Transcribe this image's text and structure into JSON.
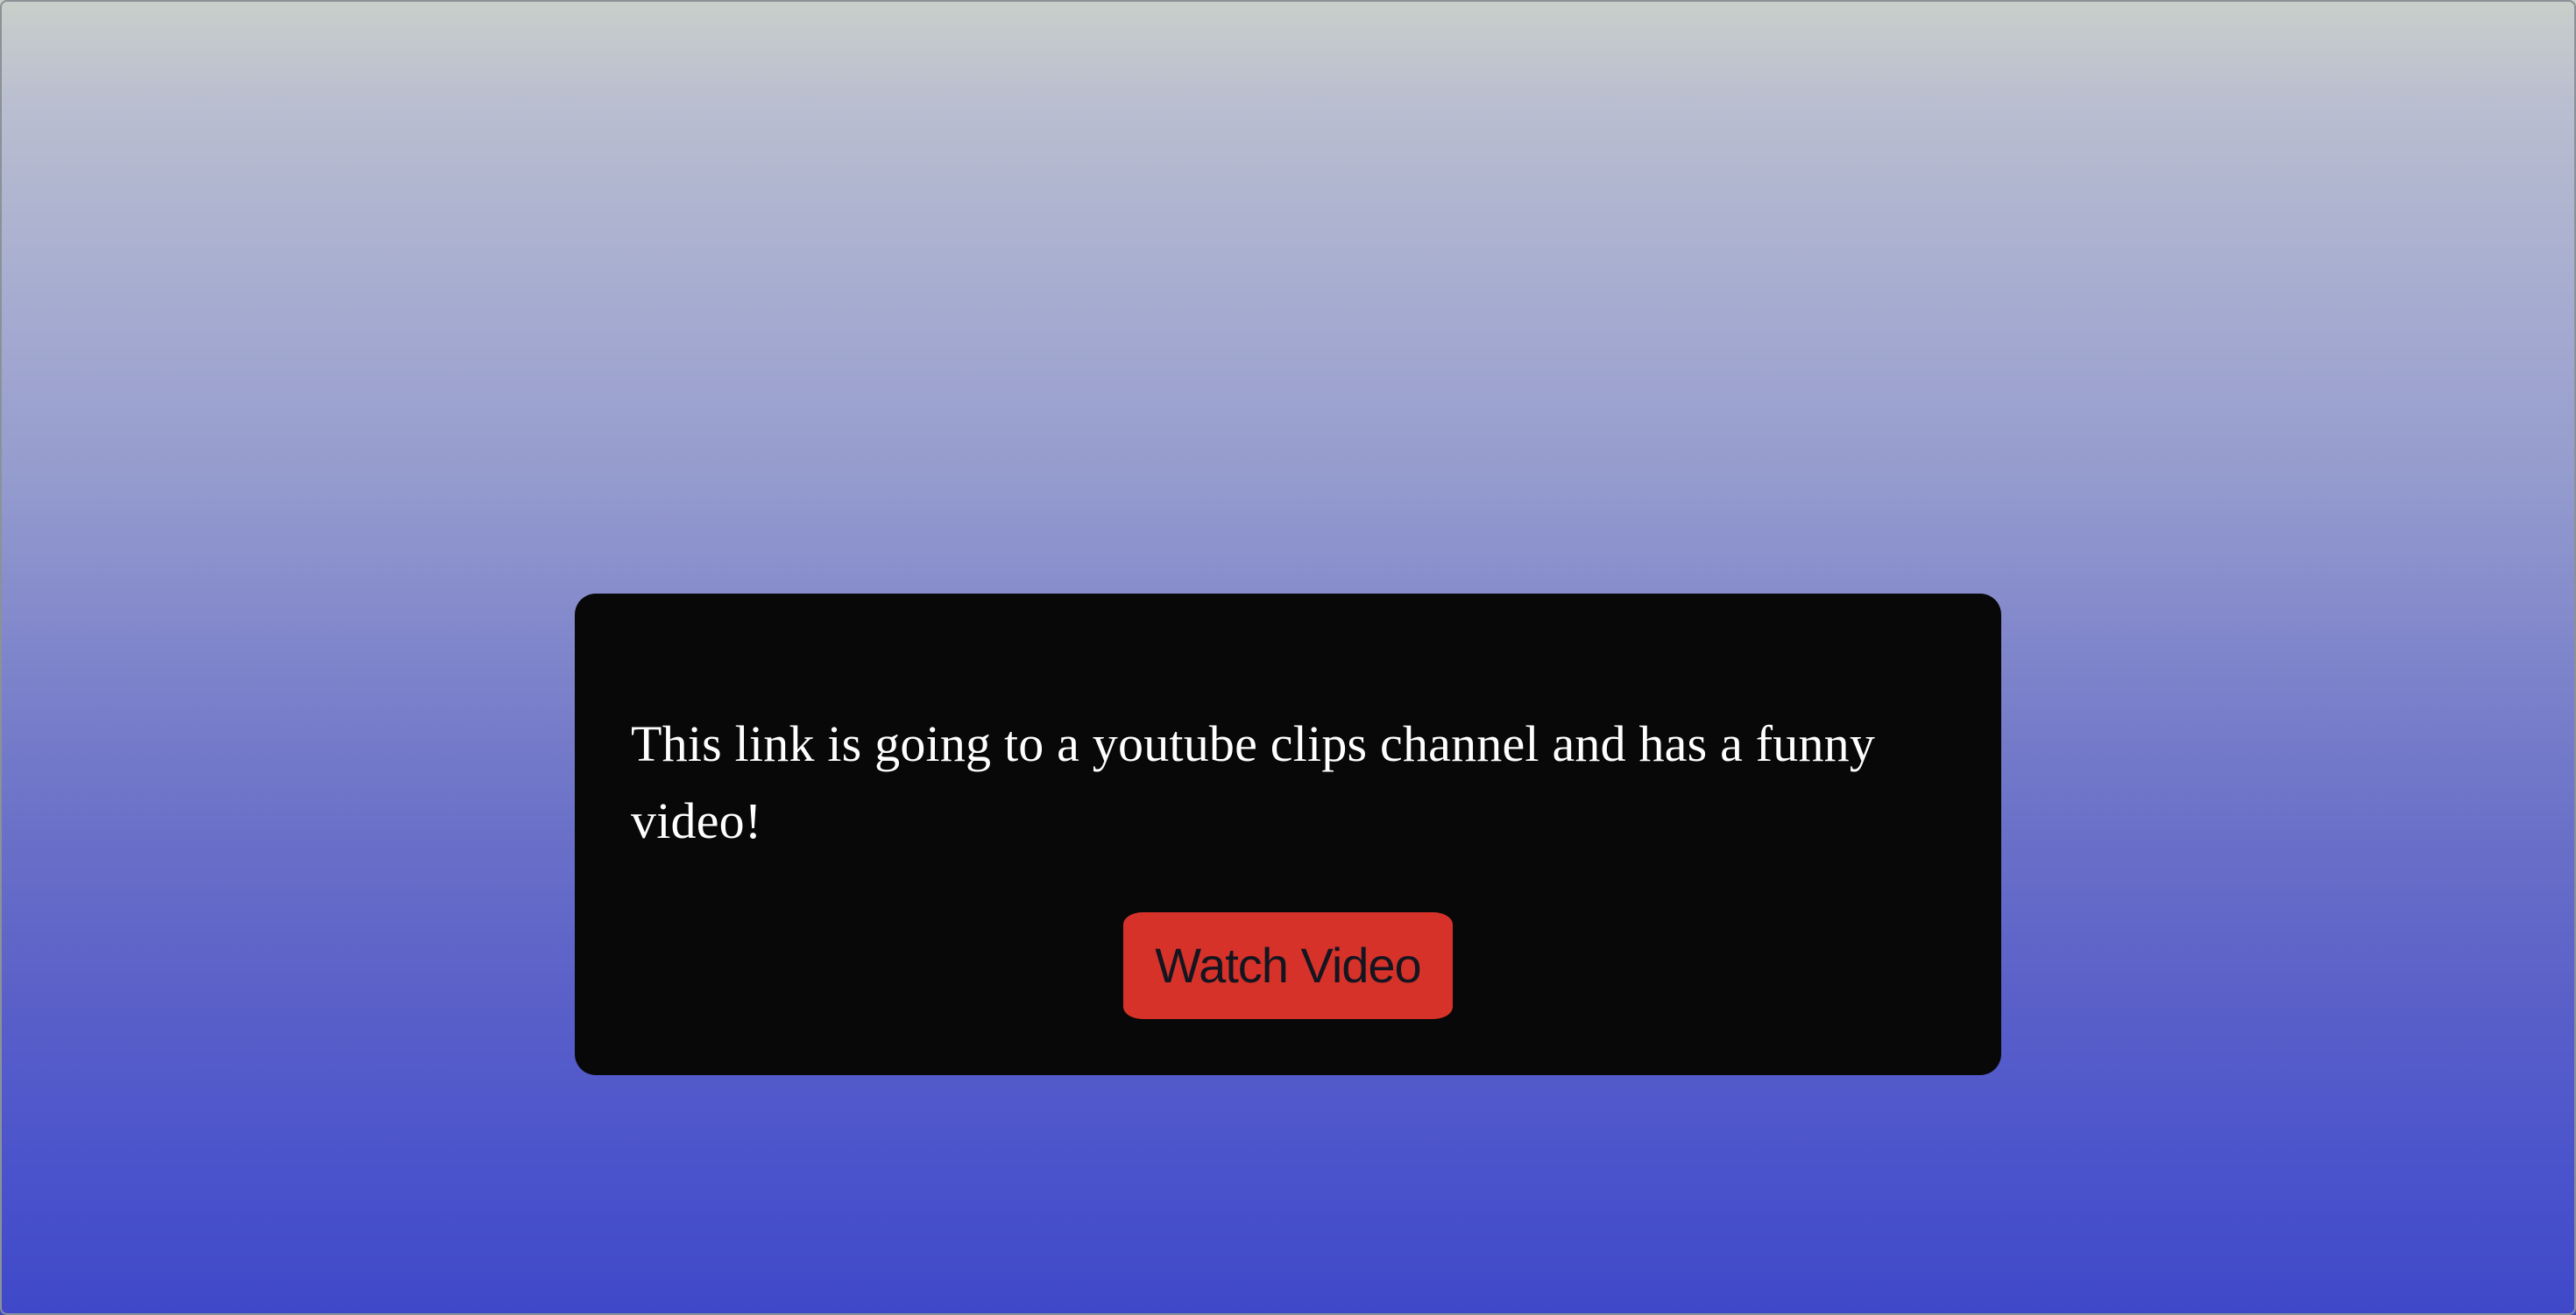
{
  "card": {
    "message": "This link is going to a youtube clips channel and has a funny video!",
    "button_label": "Watch Video"
  },
  "colors": {
    "card_background": "#080808",
    "button_background": "#d6322a",
    "button_text": "#15151f",
    "message_text": "#ffffff"
  }
}
